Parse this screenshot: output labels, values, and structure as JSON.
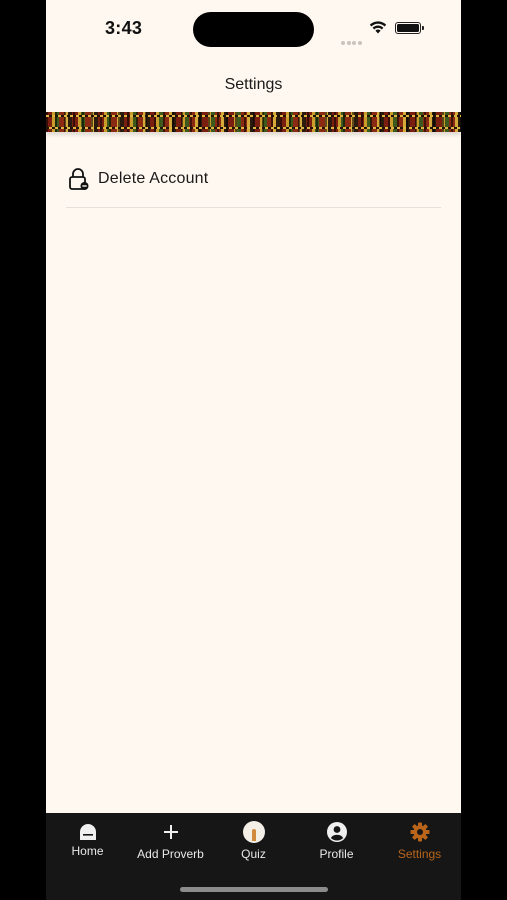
{
  "status_bar": {
    "time": "3:43"
  },
  "header": {
    "title": "Settings"
  },
  "settings": {
    "items": [
      {
        "label": "Delete Account",
        "icon": "lock-icon"
      }
    ]
  },
  "tabbar": {
    "active_color": "#b8651b",
    "tabs": [
      {
        "label": "Home",
        "icon": "home-icon"
      },
      {
        "label": "Add Proverb",
        "icon": "plus-icon"
      },
      {
        "label": "Quiz",
        "icon": "quiz-icon"
      },
      {
        "label": "Profile",
        "icon": "profile-icon"
      },
      {
        "label": "Settings",
        "icon": "gear-icon",
        "active": true
      }
    ]
  }
}
